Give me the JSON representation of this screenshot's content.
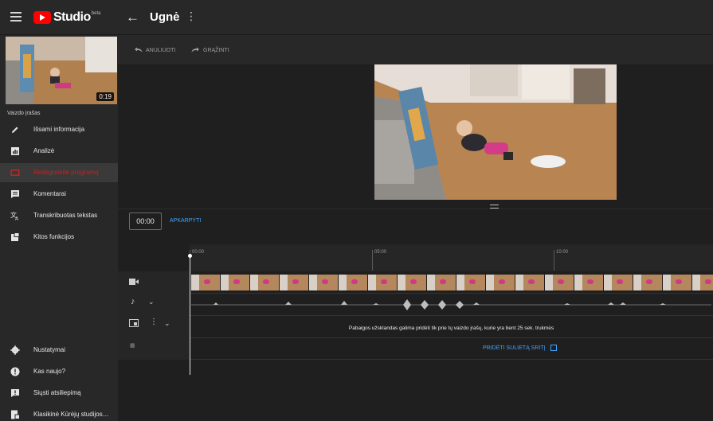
{
  "topbar": {
    "brand": "Studio",
    "brand_tag": "beta",
    "title": "Ugnė"
  },
  "sidebar": {
    "duration": "0:19",
    "section_heading": "Vaizdo įrašas",
    "items": [
      {
        "label": "Išsami informacija",
        "icon": "pencil-icon"
      },
      {
        "label": "Analizė",
        "icon": "analytics-icon"
      },
      {
        "label": "Redaguokite programą",
        "icon": "editor-icon",
        "active": true
      },
      {
        "label": "Komentarai",
        "icon": "comments-icon"
      },
      {
        "label": "Transkribuotas tekstas",
        "icon": "translate-icon"
      },
      {
        "label": "Kitos funkcijos",
        "icon": "other-features-icon"
      }
    ],
    "bottom_items": [
      {
        "label": "Nustatymai",
        "icon": "gear-icon"
      },
      {
        "label": "Kas naujo?",
        "icon": "alert-icon"
      },
      {
        "label": "Siųsti atsiliepimą",
        "icon": "feedback-icon"
      },
      {
        "label": "Klasikinė Kūrėjų studijos…",
        "icon": "classic-studio-icon"
      }
    ]
  },
  "actions": {
    "undo": "ANULIUOTI",
    "redo": "GRĄŽINTI"
  },
  "editor": {
    "time": "00:00",
    "trim": "APKARPYTI",
    "ticks": [
      "00:00",
      "05:00",
      "10:00"
    ],
    "end_screen_message": "Pabaigos užsklandas galima pridėti tik prie tų vaizdo įrašų, kurie yra bent 25 sek. trukmės",
    "blur_link": "PRIDĖTI SULIETĄ SRITĮ"
  },
  "colors": {
    "accent_blue": "#3ea6ff",
    "active_red": "#c5221f",
    "brand_red": "#ff0000"
  }
}
